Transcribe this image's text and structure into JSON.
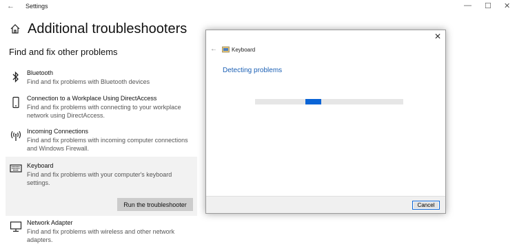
{
  "window": {
    "title": "Settings",
    "back_glyph": "←",
    "minimize_glyph": "—",
    "maximize_glyph": "☐",
    "close_glyph": "✕"
  },
  "page": {
    "title": "Additional troubleshooters",
    "section_title": "Find and fix other problems"
  },
  "items": [
    {
      "name": "Bluetooth",
      "desc": "Find and fix problems with Bluetooth devices",
      "icon": "bluetooth-icon"
    },
    {
      "name": "Connection to a Workplace Using DirectAccess",
      "desc": "Find and fix problems with connecting to your workplace network using DirectAccess.",
      "icon": "phone-icon"
    },
    {
      "name": "Incoming Connections",
      "desc": "Find and fix problems with incoming computer connections and Windows Firewall.",
      "icon": "antenna-icon"
    },
    {
      "name": "Keyboard",
      "desc": "Find and fix problems with your computer's keyboard settings.",
      "icon": "keyboard-icon",
      "button": "Run the troubleshooter"
    },
    {
      "name": "Network Adapter",
      "desc": "Find and fix problems with wireless and other network adapters.",
      "icon": "monitor-icon"
    }
  ],
  "dialog": {
    "close_glyph": "✕",
    "back_glyph": "←",
    "name": "Keyboard",
    "heading": "Detecting problems",
    "cancel_label": "Cancel",
    "accent": "#0a64d6"
  }
}
